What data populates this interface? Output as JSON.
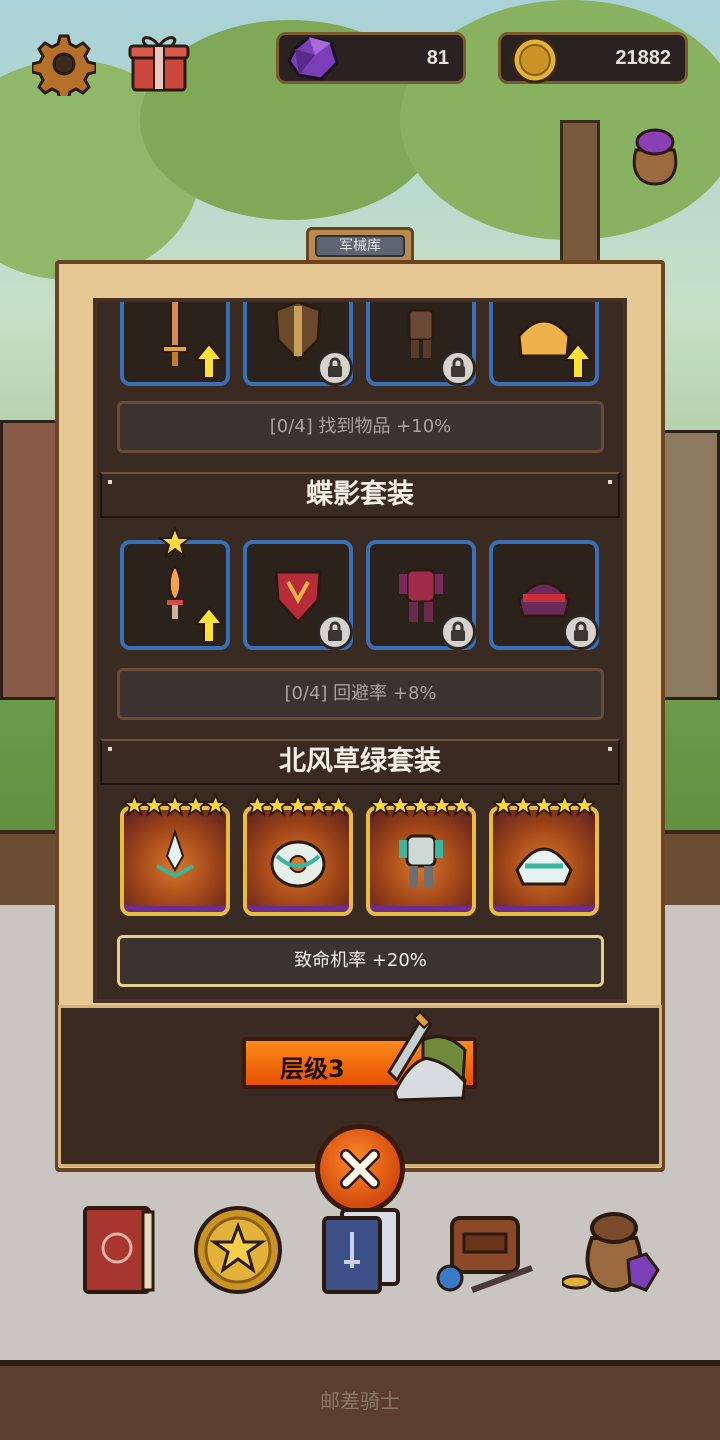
{
  "currencies": {
    "gems": "81",
    "coins": "21882"
  },
  "panel": {
    "title": "军械库"
  },
  "sets": [
    {
      "name": "",
      "bonus": "[0/4] 找到物品 +10%",
      "bonus_active": false
    },
    {
      "name": "蝶影套装",
      "bonus": "[0/4] 回避率 +8%",
      "bonus_active": false
    },
    {
      "name": "北风草绿套装",
      "bonus": "致命机率 +20%",
      "bonus_active": true
    }
  ],
  "level_button": {
    "label": "层级3"
  },
  "footer": {
    "text": "邮差骑士"
  },
  "icons": {
    "settings": "gear-icon",
    "gift": "gift-icon",
    "gem": "gem-icon",
    "coin": "coin-icon",
    "bag": "loot-bag-icon",
    "close": "close-icon",
    "nav": [
      "book-icon",
      "star-coin-icon",
      "cards-icon",
      "backpack-icon",
      "treasure-bag-icon"
    ]
  },
  "colors": {
    "slot_border_blue": "#3a6fb8",
    "slot_border_gold": "#e9bd3c",
    "accent_orange": "#ff8a1a"
  }
}
